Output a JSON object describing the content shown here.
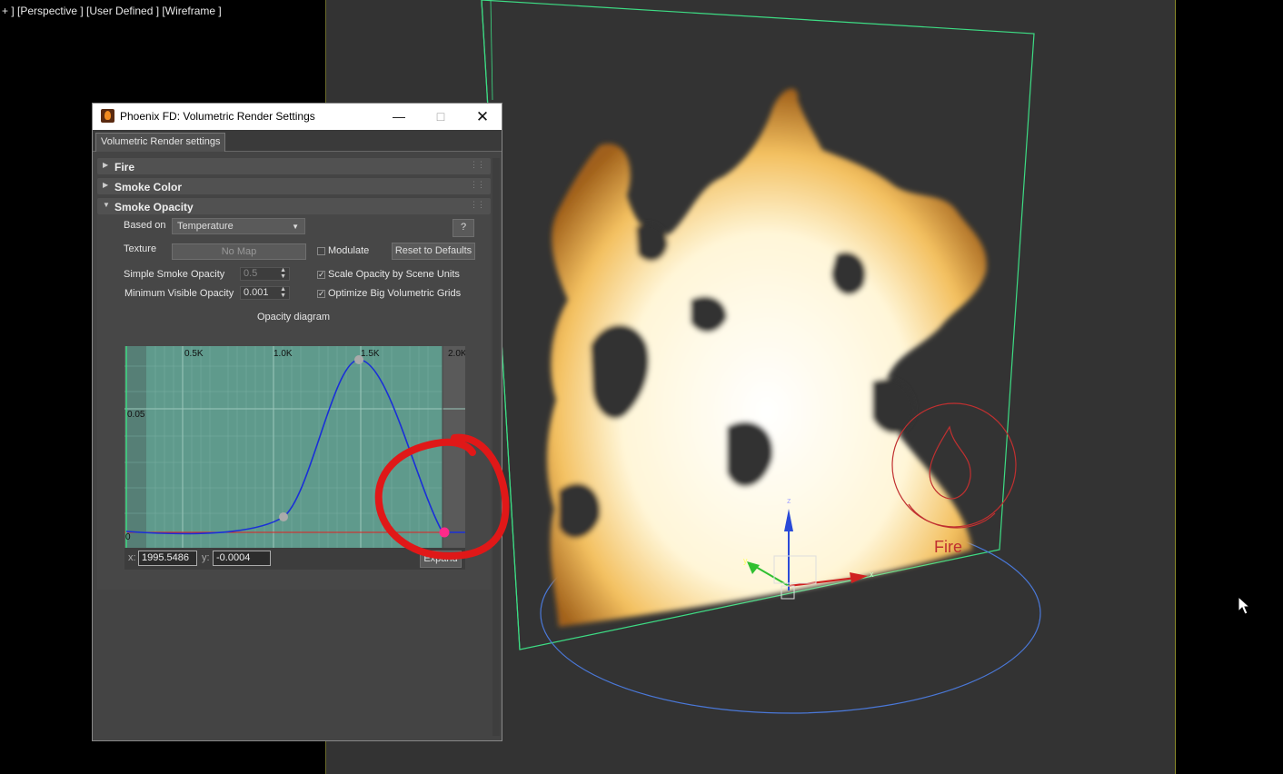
{
  "viewport": {
    "label": "+ ] [Perspective ] [User Defined ] [Wireframe ]"
  },
  "scene": {
    "helper_label": "Fire",
    "axis_z": "z",
    "axis_x": "x",
    "axis_y": "y"
  },
  "dialog": {
    "title": "Phoenix FD: Volumetric Render Settings",
    "tab": "Volumetric Render settings",
    "rollouts": [
      {
        "label": "Fire",
        "expanded": false
      },
      {
        "label": "Smoke Color",
        "expanded": false
      },
      {
        "label": "Smoke Opacity",
        "expanded": true
      }
    ],
    "smoke_opacity": {
      "based_on_label": "Based on",
      "based_on_value": "Temperature",
      "help_button": "?",
      "texture_label": "Texture",
      "texture_button": "No Map",
      "modulate_label": "Modulate",
      "modulate_checked": false,
      "reset_button": "Reset to Defaults",
      "simple_opacity_label": "Simple Smoke Opacity",
      "simple_opacity_value": "0.5",
      "min_visible_label": "Minimum Visible Opacity",
      "min_visible_value": "0.001",
      "scale_opacity_label": "Scale Opacity by Scene Units",
      "scale_opacity_checked": true,
      "optimize_label": "Optimize Big Volumetric Grids",
      "optimize_checked": true,
      "diagram_title": "Opacity diagram",
      "x_ticks": [
        "0.5K",
        "1.0K",
        "1.5K",
        "2.0K"
      ],
      "y_ticks": [
        "0.05",
        "0"
      ],
      "x_label": "x:",
      "x_value": "1995.5486",
      "y_label": "y:",
      "y_value": "-0.0004",
      "expand_button": "Expand"
    }
  },
  "colors": {
    "diagram_bg": "#5f9a8c",
    "curve": "#1a2fd8",
    "selected_point": "#ff2a8a",
    "annotation": "#e01818",
    "grid_green": "#3ddc84"
  }
}
